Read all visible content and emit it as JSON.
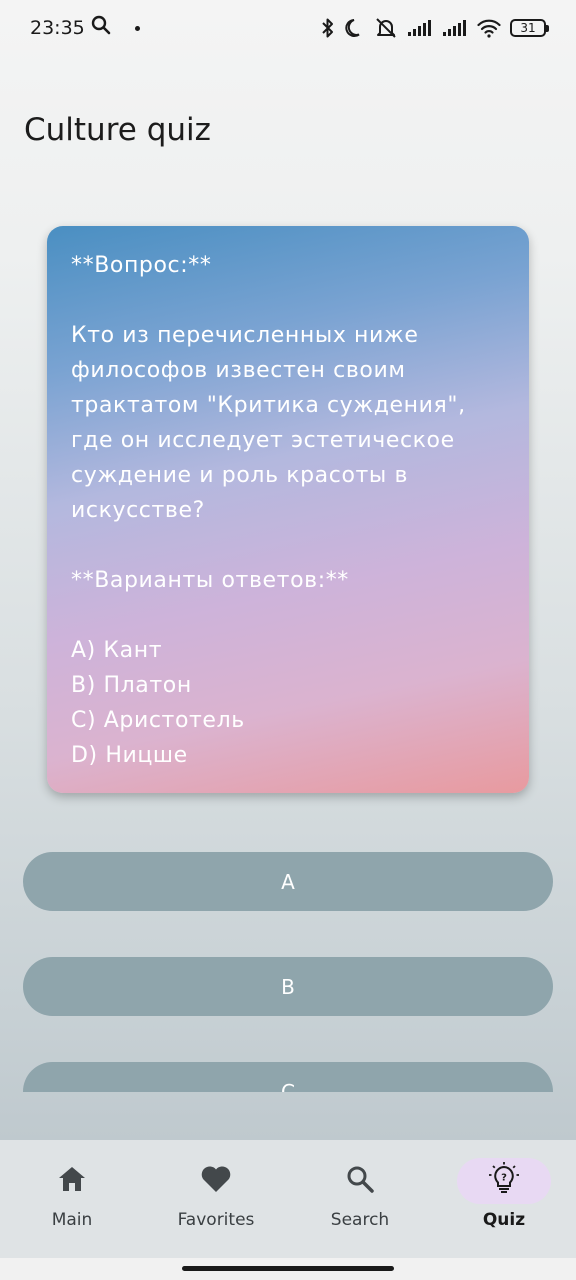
{
  "status_bar": {
    "time": "23:35",
    "battery": "31",
    "icons": [
      "search-icon",
      "bluetooth-icon",
      "moon-icon",
      "bell-off-icon",
      "signal-icon",
      "signal-icon",
      "wifi-icon",
      "battery-icon"
    ]
  },
  "page": {
    "title": "Culture quiz"
  },
  "question_card": {
    "text": "**Вопрос:**\n\nКто из перечисленных ниже философов известен своим трактатом \"Критика суждения\", где он исследует эстетическое суждение и роль красоты в искусстве?\n\n**Варианты ответов:**\n\nA) Кант\nB) Платон\nC) Аристотель\nD) Ницше"
  },
  "answers": [
    {
      "label": "A"
    },
    {
      "label": "B"
    },
    {
      "label": "C"
    }
  ],
  "bottom_nav": {
    "items": [
      {
        "label": "Main",
        "icon": "home-icon",
        "active": false
      },
      {
        "label": "Favorites",
        "icon": "heart-icon",
        "active": false
      },
      {
        "label": "Search",
        "icon": "search-icon",
        "active": false
      },
      {
        "label": "Quiz",
        "icon": "lightbulb-question-icon",
        "active": true
      }
    ]
  },
  "colors": {
    "answer_button": "#8fa5ac",
    "nav_active_pill": "#e8d9f3",
    "card_gradient_top": "#4a8fc2",
    "card_gradient_bottom": "#e89a9f"
  }
}
